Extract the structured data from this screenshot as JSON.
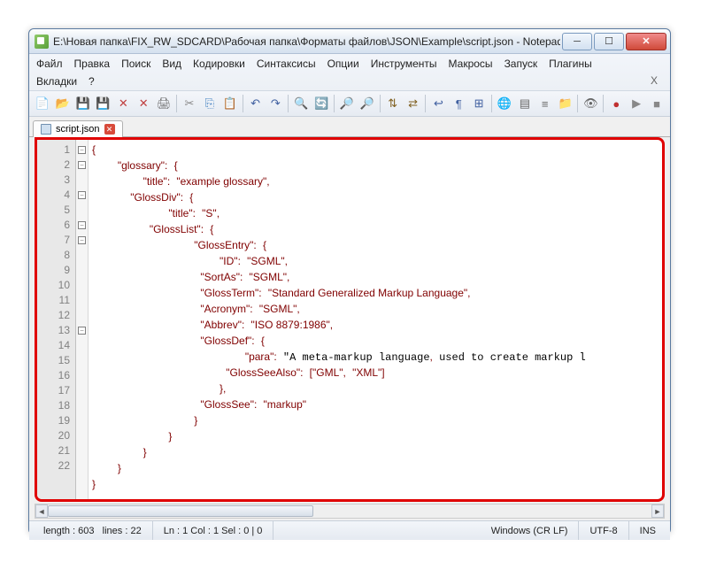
{
  "title": "E:\\Новая папка\\FIX_RW_SDCARD\\Рабочая папка\\Форматы файлов\\JSON\\Example\\script.json - Notepad+...",
  "menu": [
    "Файл",
    "Правка",
    "Поиск",
    "Вид",
    "Кодировки",
    "Синтаксисы",
    "Опции",
    "Инструменты",
    "Макросы",
    "Запуск",
    "Плагины",
    "Вкладки",
    "?"
  ],
  "menu_close": "X",
  "tab": {
    "label": "script.json"
  },
  "line_numbers": [
    "1",
    "2",
    "3",
    "4",
    "5",
    "6",
    "7",
    "8",
    "9",
    "10",
    "11",
    "12",
    "13",
    "14",
    "15",
    "16",
    "17",
    "18",
    "19",
    "20",
    "21",
    "22"
  ],
  "code_lines": [
    "{",
    "    \"glossary\": {",
    "        \"title\": \"example glossary\",",
    "      \"GlossDiv\": {",
    "            \"title\": \"S\",",
    "         \"GlossList\": {",
    "                \"GlossEntry\": {",
    "                    \"ID\": \"SGML\",",
    "                 \"SortAs\": \"SGML\",",
    "                 \"GlossTerm\": \"Standard Generalized Markup Language\",",
    "                 \"Acronym\": \"SGML\",",
    "                 \"Abbrev\": \"ISO 8879:1986\",",
    "                 \"GlossDef\": {",
    "                        \"para\": \"A meta-markup language, used to create markup l",
    "                     \"GlossSeeAlso\": [\"GML\", \"XML\"]",
    "                    },",
    "                 \"GlossSee\": \"markup\"",
    "                }",
    "            }",
    "        }",
    "    }",
    "}"
  ],
  "fold_rows": [
    1,
    2,
    4,
    6,
    7,
    13
  ],
  "status": {
    "length": "length : 603",
    "lines": "lines : 22",
    "pos": "Ln : 1   Col : 1   Sel : 0 | 0",
    "eol": "Windows (CR LF)",
    "enc": "UTF-8",
    "mode": "INS"
  },
  "toolbar_icons": [
    {
      "name": "new-file-icon",
      "glyph": "📄",
      "c": "#d4a850"
    },
    {
      "name": "open-file-icon",
      "glyph": "📂",
      "c": "#d4a850"
    },
    {
      "name": "save-icon",
      "glyph": "💾",
      "c": "#5070c0"
    },
    {
      "name": "save-all-icon",
      "glyph": "💾",
      "c": "#5070c0"
    },
    {
      "name": "close-icon",
      "glyph": "✕",
      "c": "#c04040"
    },
    {
      "name": "close-all-icon",
      "glyph": "✕",
      "c": "#c04040"
    },
    {
      "name": "print-icon",
      "glyph": "🖨",
      "c": "#666"
    },
    {
      "sep": true
    },
    {
      "name": "cut-icon",
      "glyph": "✂",
      "c": "#888"
    },
    {
      "name": "copy-icon",
      "glyph": "⎘",
      "c": "#4080c0"
    },
    {
      "name": "paste-icon",
      "glyph": "📋",
      "c": "#c09040"
    },
    {
      "sep": true
    },
    {
      "name": "undo-icon",
      "glyph": "↶",
      "c": "#4060a0"
    },
    {
      "name": "redo-icon",
      "glyph": "↷",
      "c": "#4060a0"
    },
    {
      "sep": true
    },
    {
      "name": "find-icon",
      "glyph": "🔍",
      "c": "#666"
    },
    {
      "name": "replace-icon",
      "glyph": "🔄",
      "c": "#666"
    },
    {
      "sep": true
    },
    {
      "name": "zoom-in-icon",
      "glyph": "🔎",
      "c": "#666"
    },
    {
      "name": "zoom-out-icon",
      "glyph": "🔎",
      "c": "#666"
    },
    {
      "sep": true
    },
    {
      "name": "sync-v-icon",
      "glyph": "⇅",
      "c": "#806020"
    },
    {
      "name": "sync-h-icon",
      "glyph": "⇄",
      "c": "#806020"
    },
    {
      "sep": true
    },
    {
      "name": "wordwrap-icon",
      "glyph": "↩",
      "c": "#4060a0"
    },
    {
      "name": "allchars-icon",
      "glyph": "¶",
      "c": "#4060a0"
    },
    {
      "name": "indent-guide-icon",
      "glyph": "⊞",
      "c": "#4060a0"
    },
    {
      "sep": true
    },
    {
      "name": "lang-icon",
      "glyph": "🌐",
      "c": "#50a050"
    },
    {
      "name": "doc-map-icon",
      "glyph": "▤",
      "c": "#666"
    },
    {
      "name": "func-list-icon",
      "glyph": "≡",
      "c": "#666"
    },
    {
      "name": "folder-view-icon",
      "glyph": "📁",
      "c": "#c09040"
    },
    {
      "sep": true
    },
    {
      "name": "monitor-icon",
      "glyph": "👁",
      "c": "#666"
    },
    {
      "sep": true
    },
    {
      "name": "record-icon",
      "glyph": "●",
      "c": "#c03030"
    },
    {
      "name": "play-icon",
      "glyph": "▶",
      "c": "#888"
    },
    {
      "name": "stop-icon",
      "glyph": "■",
      "c": "#888"
    }
  ]
}
